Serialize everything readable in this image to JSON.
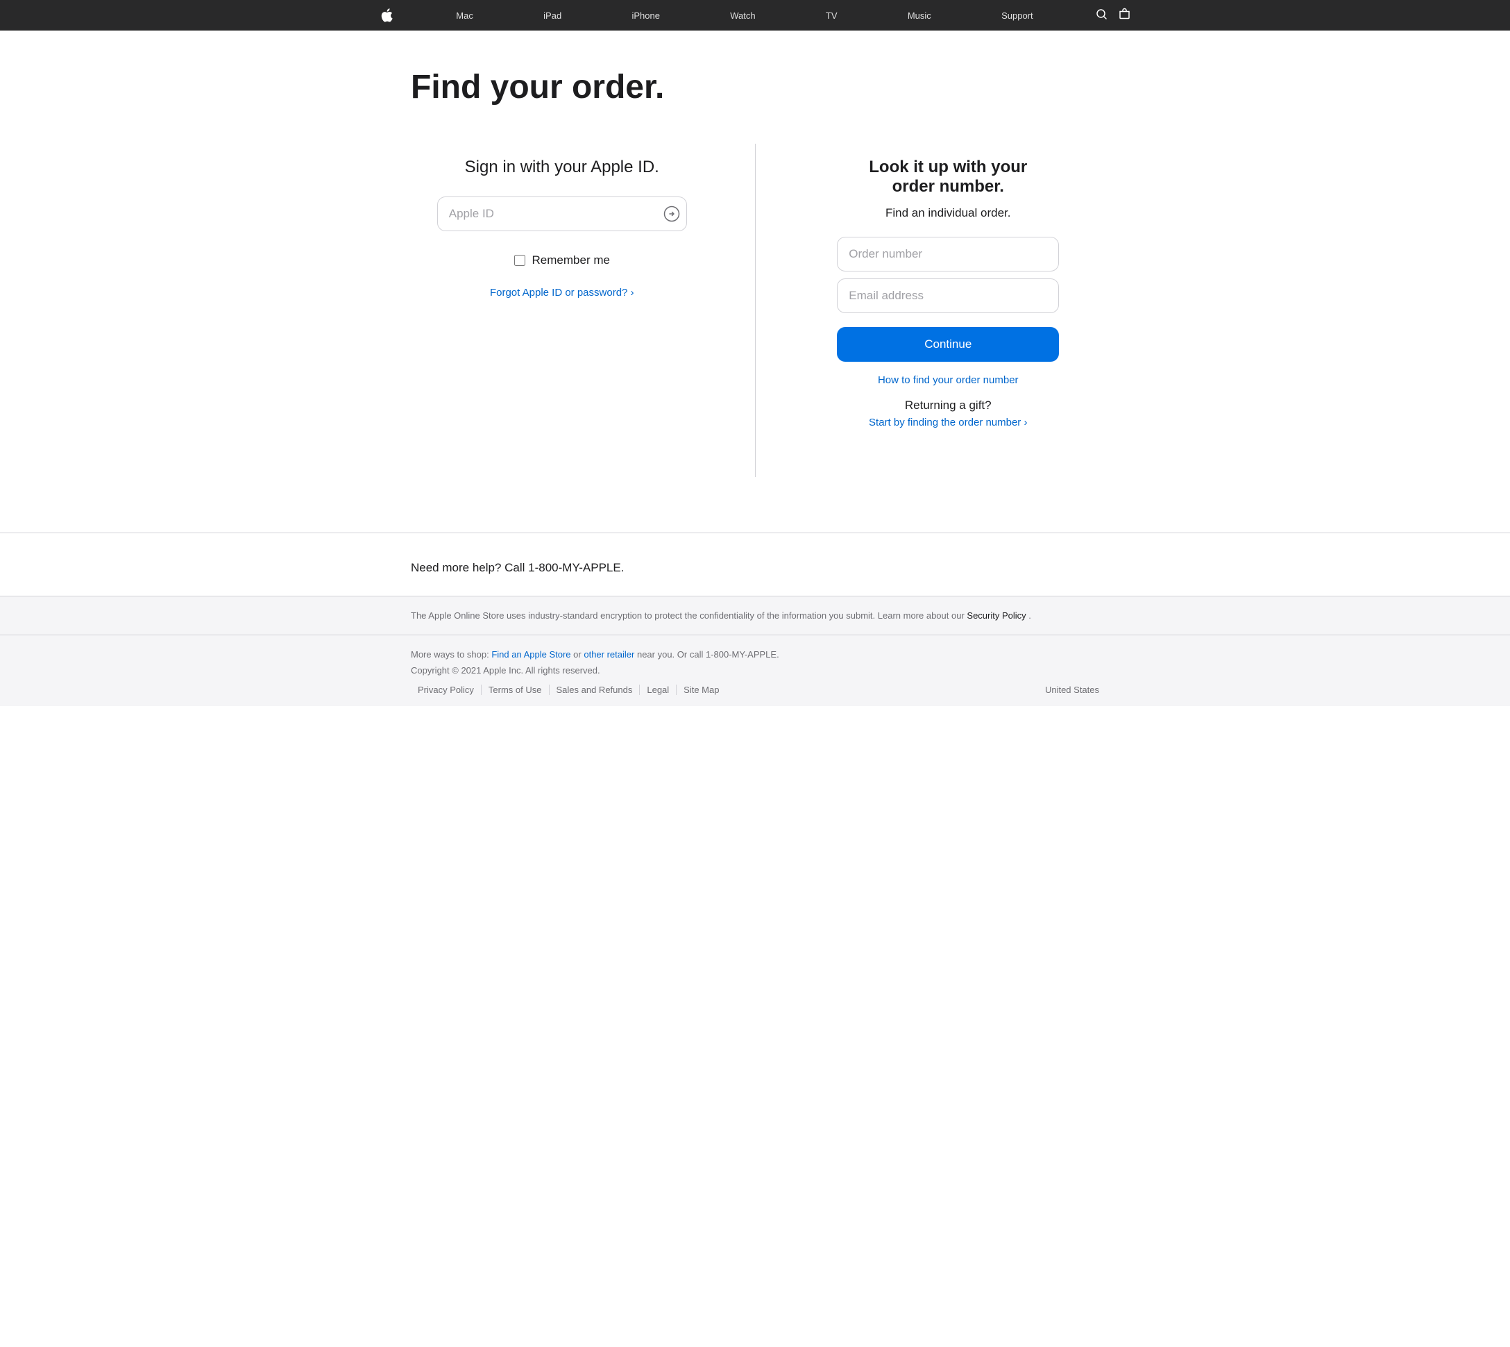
{
  "nav": {
    "apple_label": "",
    "items": [
      {
        "id": "mac",
        "label": "Mac"
      },
      {
        "id": "ipad",
        "label": "iPad"
      },
      {
        "id": "iphone",
        "label": "iPhone"
      },
      {
        "id": "watch",
        "label": "Watch"
      },
      {
        "id": "tv",
        "label": "TV"
      },
      {
        "id": "music",
        "label": "Music"
      },
      {
        "id": "support",
        "label": "Support"
      }
    ],
    "search_label": "search",
    "bag_label": "bag"
  },
  "page": {
    "title": "Find your order.",
    "left": {
      "heading": "Sign in with your Apple ID.",
      "apple_id_placeholder": "Apple ID",
      "remember_label": "Remember me",
      "forgot_link": "Forgot Apple ID or password? ›"
    },
    "right": {
      "heading": "Look it up with your order number.",
      "subtext": "Find an individual order.",
      "order_placeholder": "Order number",
      "email_placeholder": "Email address",
      "continue_label": "Continue",
      "how_to_link": "How to find your order number",
      "returning_title": "Returning a gift?",
      "start_link": "Start by finding the order number ›"
    }
  },
  "footer": {
    "help_text": "Need more help? Call 1-800-MY-APPLE.",
    "security_text_before": "The Apple Online Store uses industry-standard encryption to protect the confidentiality of the information you submit. Learn more about our",
    "security_link": "Security Policy",
    "security_text_after": ".",
    "more_ways_before": "More ways to shop:",
    "find_store_link": "Find an Apple Store",
    "or_text": "or",
    "other_retailer_link": "other retailer",
    "near_text": "near you. Or call 1-800-MY-APPLE.",
    "copyright": "Copyright © 2021 Apple Inc. All rights reserved.",
    "links": [
      {
        "id": "privacy",
        "label": "Privacy Policy"
      },
      {
        "id": "terms",
        "label": "Terms of Use"
      },
      {
        "id": "sales",
        "label": "Sales and Refunds"
      },
      {
        "id": "legal",
        "label": "Legal"
      },
      {
        "id": "sitemap",
        "label": "Site Map"
      }
    ],
    "country": "United States"
  }
}
